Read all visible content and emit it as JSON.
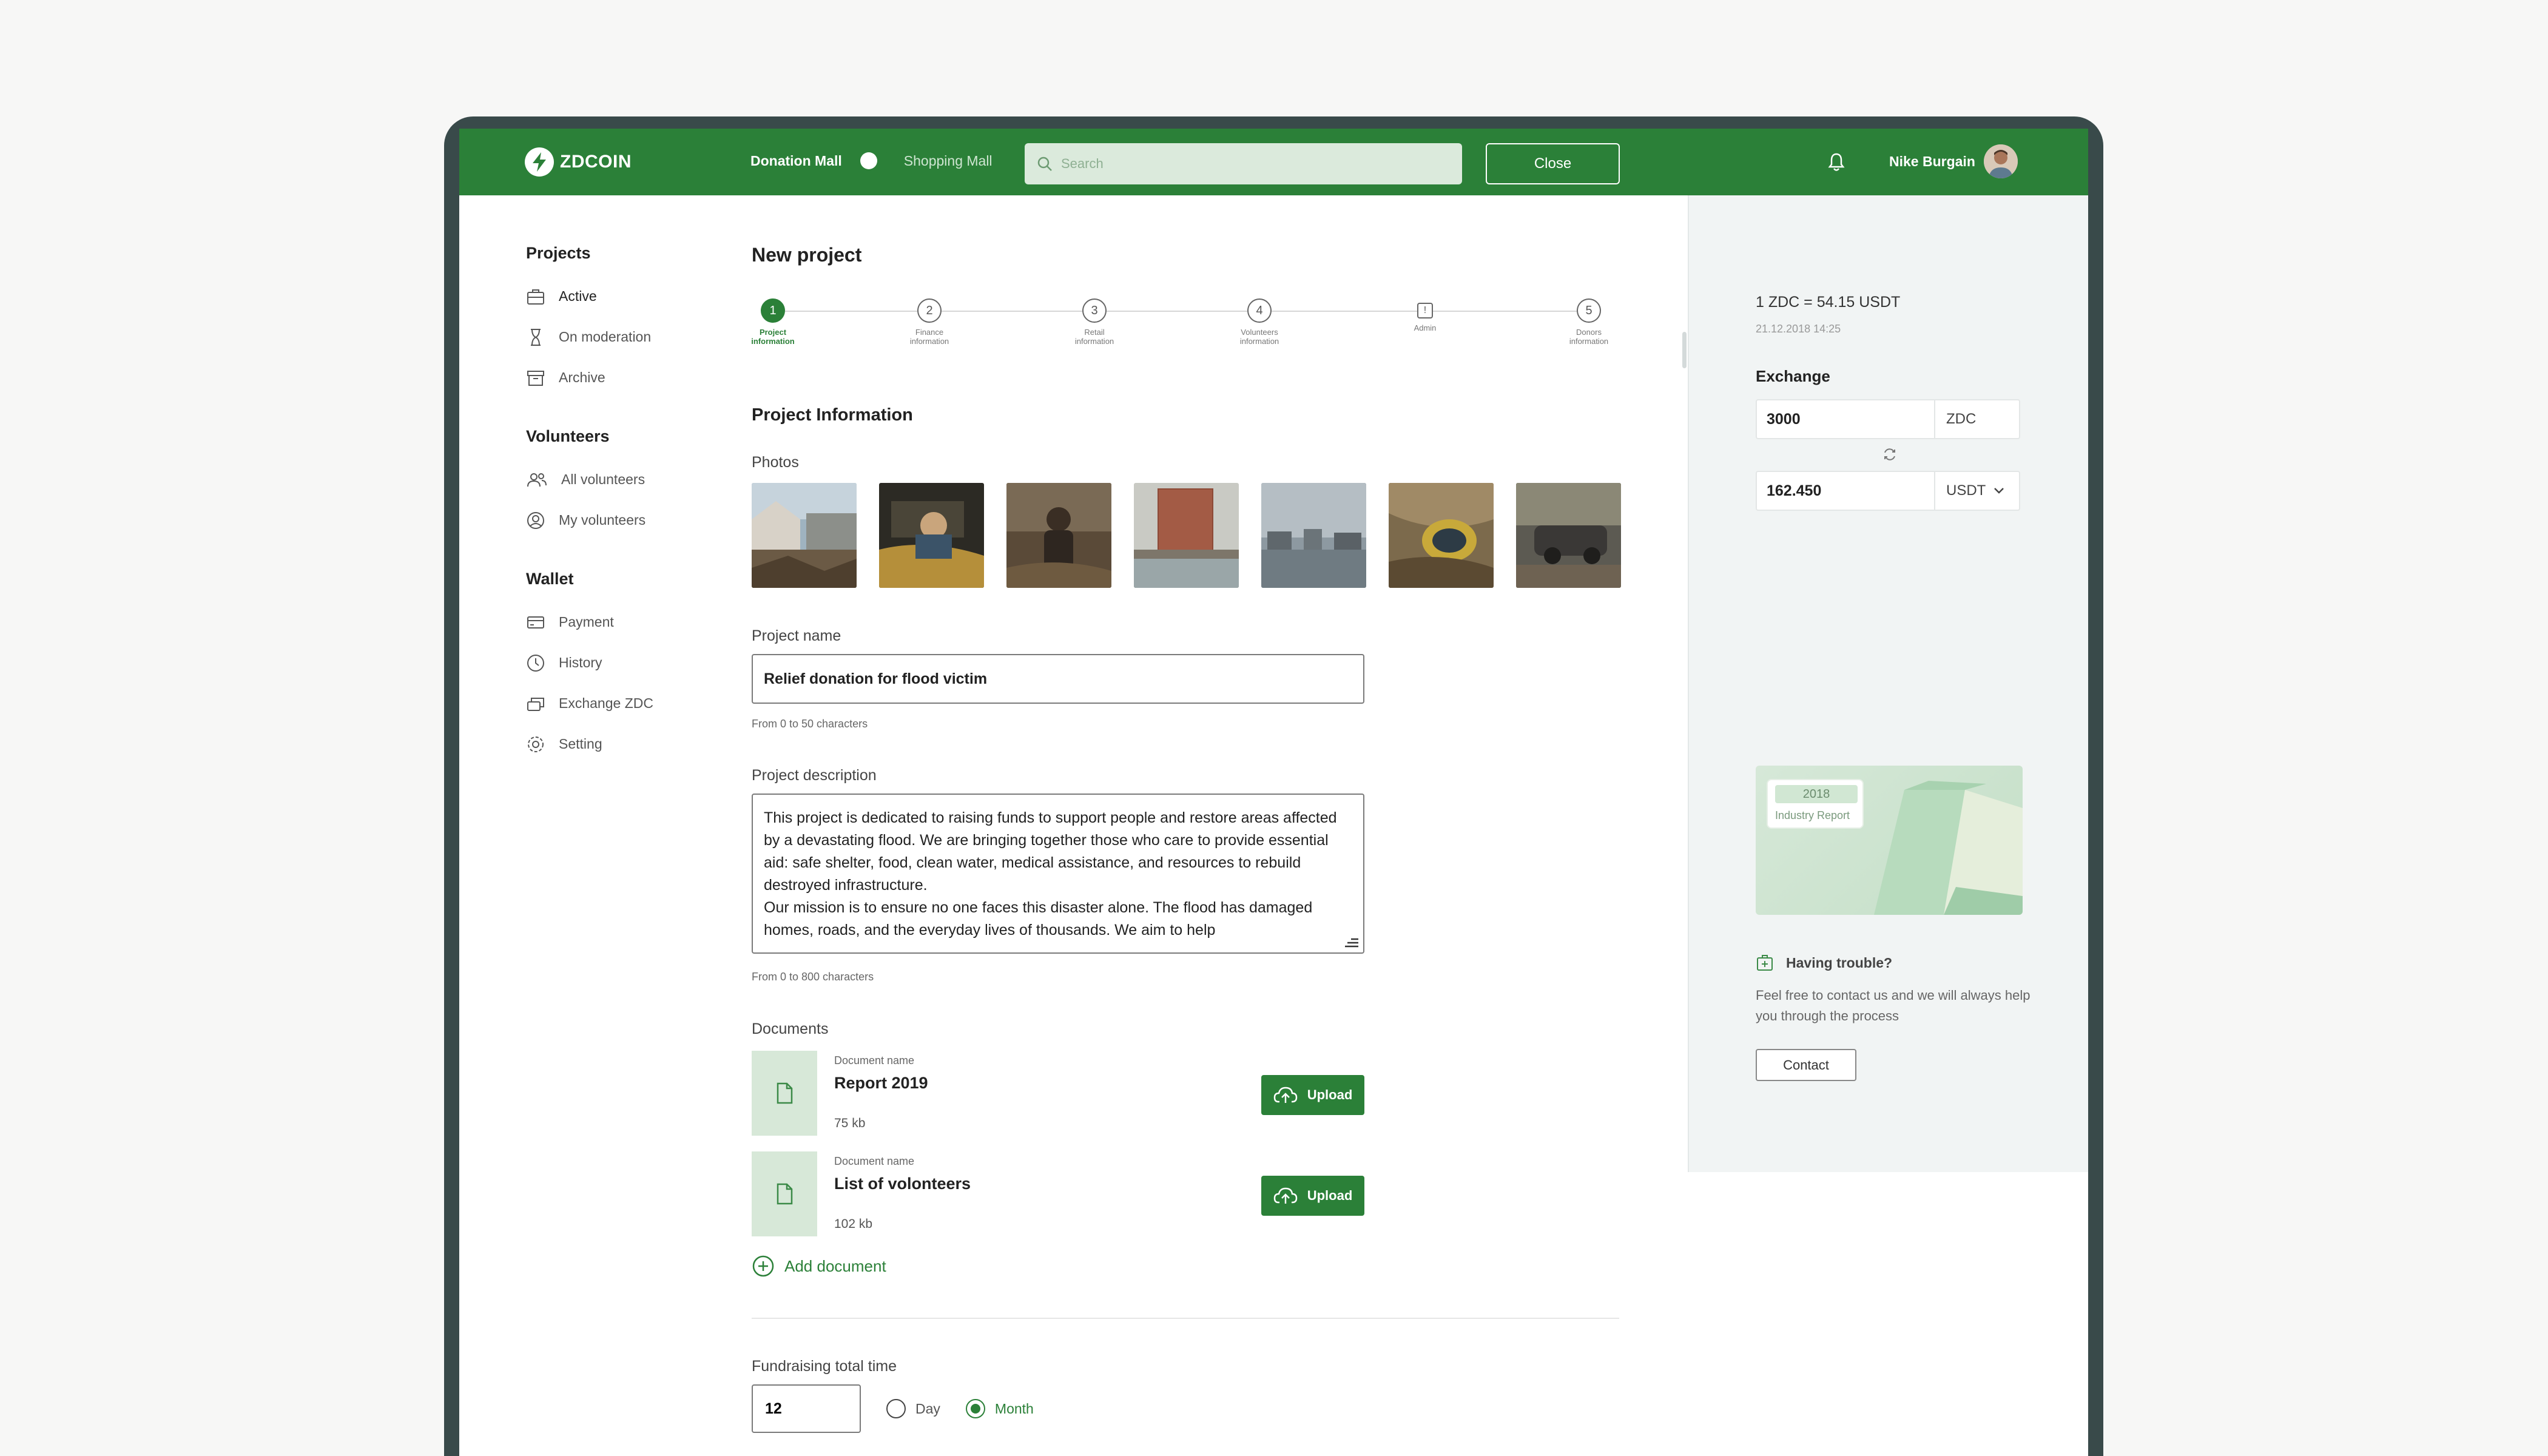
{
  "topbar": {
    "logo": "ZDCOIN",
    "mall_active": "Donation Mall",
    "mall_inactive": "Shopping Mall",
    "search_placeholder": "Search",
    "close_label": "Close",
    "user_name": "Nike Burgain"
  },
  "sidebar": {
    "groups": [
      {
        "title": "Projects",
        "items": [
          {
            "label": "Active",
            "icon": "briefcase-icon"
          },
          {
            "label": "On moderation",
            "icon": "hourglass-icon"
          },
          {
            "label": "Archive",
            "icon": "archive-icon"
          }
        ]
      },
      {
        "title": "Volunteers",
        "items": [
          {
            "label": "All volunteers",
            "icon": "users-icon"
          },
          {
            "label": "My volunteers",
            "icon": "user-circle-icon"
          }
        ]
      },
      {
        "title": "Wallet",
        "items": [
          {
            "label": "Payment",
            "icon": "card-icon"
          },
          {
            "label": "History",
            "icon": "clock-icon"
          },
          {
            "label": "Exchange ZDC",
            "icon": "exchange-icon"
          },
          {
            "label": "Setting",
            "icon": "gear-icon"
          }
        ]
      }
    ]
  },
  "main": {
    "title": "New project",
    "steps": [
      {
        "num": "1",
        "label": "Project information",
        "current": true
      },
      {
        "num": "2",
        "label": "Finance information"
      },
      {
        "num": "3",
        "label": "Retail information"
      },
      {
        "num": "4",
        "label": "Volunteers information"
      },
      {
        "num": "!",
        "label": "Admin"
      },
      {
        "num": "5",
        "label": "Donors information"
      }
    ],
    "section_title": "Project Information",
    "photos_label": "Photos",
    "project_name_label": "Project name",
    "project_name_value": "Relief donation for flood victim",
    "project_name_hint": "From 0 to 50 characters",
    "description_label": "Project description",
    "description_value": "This project is dedicated to raising funds to support people and restore areas affected by a devastating flood. We are bringing together those who care to provide essential aid: safe shelter, food, clean water, medical assistance, and resources to rebuild destroyed infrastructure.\nOur mission is to ensure no one faces this disaster alone. The flood has damaged homes, roads, and the everyday lives of thousands. We aim to help",
    "description_hint": "From 0 to 800 characters",
    "documents_label": "Documents",
    "documents": [
      {
        "caption": "Document name",
        "name": "Report 2019",
        "size": "75 kb",
        "action": "Upload"
      },
      {
        "caption": "Document name",
        "name": "List of volonteers",
        "size": "102 kb",
        "action": "Upload"
      }
    ],
    "add_document": "Add document",
    "fundraising_label": "Fundraising total time",
    "fundraising_value": "12",
    "period_options": [
      "Day",
      "Month"
    ],
    "period_selected": "Month"
  },
  "right": {
    "rate": "1 ZDC = 54.15 USDT",
    "rate_time": "21.12.2018 14:25",
    "exchange_title": "Exchange",
    "from_value": "3000",
    "from_currency": "ZDC",
    "to_value": "162.450",
    "to_currency": "USDT",
    "promo_year": "2018",
    "promo_sub": "Industry Report",
    "trouble_title": "Having trouble?",
    "trouble_text": "Feel free to contact us and we will always help you through the process",
    "contact_label": "Contact"
  },
  "colors": {
    "brand": "#2b8038",
    "brand_light": "#d7e8d8",
    "frame": "#394a4a"
  }
}
